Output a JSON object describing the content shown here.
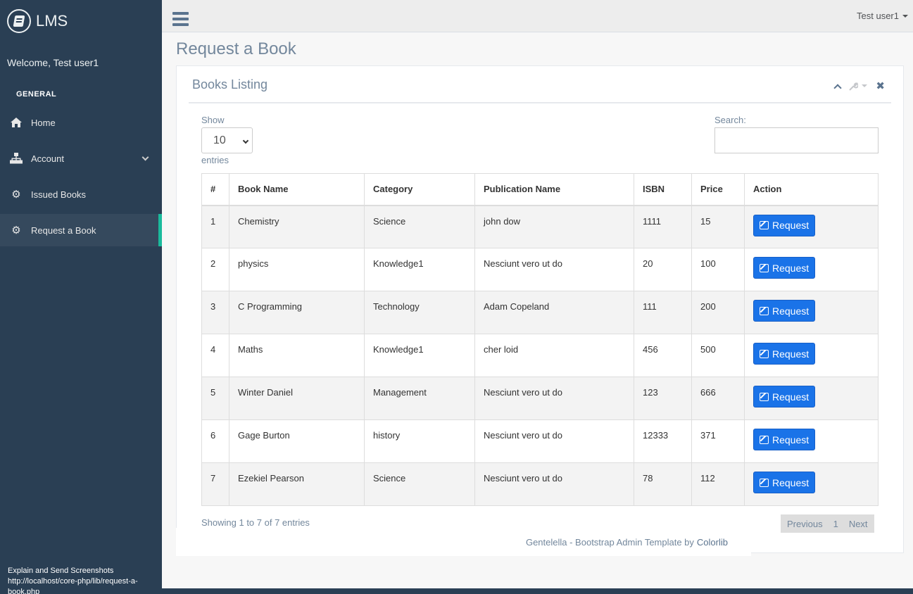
{
  "brand": {
    "name": "LMS"
  },
  "sidebar": {
    "welcome": "Welcome, Test user1",
    "section_title": "GENERAL",
    "items": [
      {
        "label": "Home",
        "icon": "home-icon"
      },
      {
        "label": "Account",
        "icon": "sitemap-icon"
      },
      {
        "label": "Issued Books",
        "icon": "gear-icon"
      },
      {
        "label": "Request a Book",
        "icon": "gear-icon"
      }
    ]
  },
  "topnav": {
    "user": "Test user1"
  },
  "page": {
    "title": "Request a Book"
  },
  "panel": {
    "title": "Books Listing"
  },
  "datatable": {
    "show_label": "Show",
    "length_value": "10",
    "entries_label": "entries",
    "search_label": "Search:",
    "search_value": "",
    "columns": [
      "#",
      "Book Name",
      "Category",
      "Publication Name",
      "ISBN",
      "Price",
      "Action"
    ],
    "rows": [
      [
        "1",
        "Chemistry",
        "Science",
        "john dow",
        "1111",
        "15"
      ],
      [
        "2",
        "physics",
        "Knowledge1",
        "Nesciunt vero ut do",
        "20",
        "100"
      ],
      [
        "3",
        "C Programming",
        "Technology",
        "Adam Copeland",
        "111",
        "200"
      ],
      [
        "4",
        "Maths",
        "Knowledge1",
        "cher loid",
        "456",
        "500"
      ],
      [
        "5",
        "Winter Daniel",
        "Management",
        "Nesciunt vero ut do",
        "123",
        "666"
      ],
      [
        "6",
        "Gage Burton",
        "history",
        "Nesciunt vero ut do",
        "12333",
        "371"
      ],
      [
        "7",
        "Ezekiel Pearson",
        "Science",
        "Nesciunt vero ut do",
        "78",
        "112"
      ]
    ],
    "action_label": "Request",
    "info": "Showing 1 to 7 of 7 entries",
    "pager": {
      "previous": "Previous",
      "current": "1",
      "next": "Next"
    }
  },
  "footer": {
    "text": "Gentelella - Bootstrap Admin Template by",
    "link": "Colorlib"
  },
  "status_bar": {
    "line1": "Explain and Send Screenshots",
    "line2": "http://localhost/core-php/lib/request-a-book.php"
  },
  "colors": {
    "sidebar_bg": "#2A3F54",
    "active_accent": "#1ABB9C",
    "request_button": "#1A73E8"
  }
}
